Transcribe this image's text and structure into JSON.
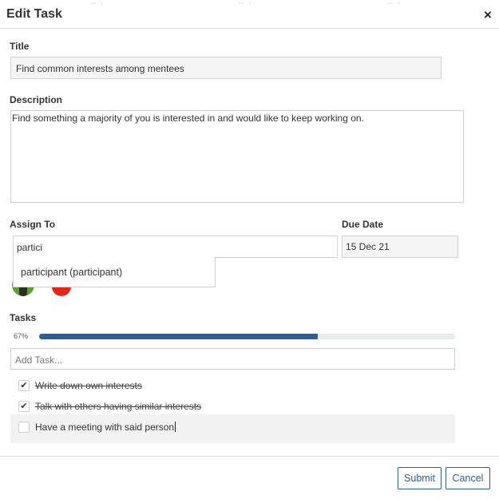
{
  "modal": {
    "title": "Edit Task",
    "close_glyph": "×",
    "background_ghost_text": "' .. '."
  },
  "form": {
    "title_label": "Title",
    "title_value": "Find common interests among mentees",
    "description_label": "Description",
    "description_value": "Find something a majority of you is interested in and would like to keep working on.",
    "assign_to_label": "Assign To",
    "assign_to_value": "partici",
    "assign_suggestions": [
      "participant (participant)"
    ],
    "due_date_label": "Due Date",
    "due_date_value": "15 Dec 21",
    "assignees": [
      {
        "icon": "avatar-green",
        "color": "#5f9e3d"
      },
      {
        "icon": "avatar-red",
        "color": "#e0291b"
      }
    ]
  },
  "tasks": {
    "label": "Tasks",
    "progress_label": "67%",
    "progress_fraction": 0.67,
    "add_placeholder": "Add Task...",
    "items": [
      {
        "text": "Write down own interests",
        "done": true
      },
      {
        "text": "Talk with others having similar interests",
        "done": true
      },
      {
        "text": "Have a meeting with said person",
        "done": false
      }
    ]
  },
  "footer": {
    "submit_label": "Submit",
    "cancel_label": "Cancel"
  },
  "colors": {
    "accent": "#2f5d8e",
    "progress_track": "#e9ecef"
  }
}
